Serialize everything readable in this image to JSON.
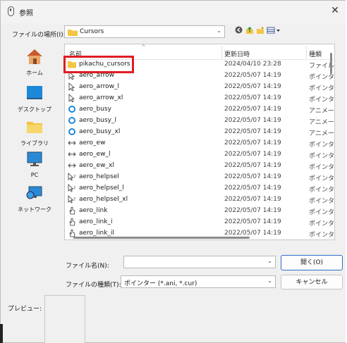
{
  "window": {
    "title": "参照",
    "close_glyph": "✕"
  },
  "location": {
    "label": "ファイルの場所(I):",
    "value": "Cursors"
  },
  "toolbar": {
    "back_glyph": "◀",
    "up_glyph": "↑",
    "newfolder_glyph": "✱",
    "view_glyph": "▤▾"
  },
  "places": [
    {
      "label": "ホーム",
      "icon": "home-icon"
    },
    {
      "label": "デスクトップ",
      "icon": "desktop-icon"
    },
    {
      "label": "ライブラリ",
      "icon": "library-folder-icon"
    },
    {
      "label": "PC",
      "icon": "pc-monitor-icon"
    },
    {
      "label": "ネットワーク",
      "icon": "network-icon"
    }
  ],
  "columns": {
    "name": "名前",
    "date": "更新日時",
    "type": "種類"
  },
  "files": [
    {
      "name": "pikachu_cursors",
      "date": "2024/04/10 23:28",
      "type": "ファイル フ",
      "icon": "folder-icon"
    },
    {
      "name": "aero_arrow",
      "date": "2022/05/07 14:19",
      "type": "ポインター",
      "icon": "arrow-cursor-icon"
    },
    {
      "name": "aero_arrow_l",
      "date": "2022/05/07 14:19",
      "type": "ポインター",
      "icon": "arrow-cursor-icon"
    },
    {
      "name": "aero_arrow_xl",
      "date": "2022/05/07 14:19",
      "type": "ポインター",
      "icon": "arrow-cursor-icon"
    },
    {
      "name": "aero_busy",
      "date": "2022/05/07 14:19",
      "type": "アニメーシ",
      "icon": "busy-ring-icon"
    },
    {
      "name": "aero_busy_l",
      "date": "2022/05/07 14:19",
      "type": "アニメーシ",
      "icon": "busy-ring-icon"
    },
    {
      "name": "aero_busy_xl",
      "date": "2022/05/07 14:19",
      "type": "アニメーシ",
      "icon": "busy-ring-icon"
    },
    {
      "name": "aero_ew",
      "date": "2022/05/07 14:19",
      "type": "ポインター",
      "icon": "resize-ew-icon"
    },
    {
      "name": "aero_ew_l",
      "date": "2022/05/07 14:19",
      "type": "ポインター",
      "icon": "resize-ew-icon"
    },
    {
      "name": "aero_ew_xl",
      "date": "2022/05/07 14:19",
      "type": "ポインター",
      "icon": "resize-ew-icon"
    },
    {
      "name": "aero_helpsel",
      "date": "2022/05/07 14:19",
      "type": "ポインター",
      "icon": "help-cursor-icon"
    },
    {
      "name": "aero_helpsel_l",
      "date": "2022/05/07 14:19",
      "type": "ポインター",
      "icon": "help-cursor-icon"
    },
    {
      "name": "aero_helpsel_xl",
      "date": "2022/05/07 14:19",
      "type": "ポインター",
      "icon": "help-cursor-icon"
    },
    {
      "name": "aero_link",
      "date": "2022/05/07 14:19",
      "type": "ポインター",
      "icon": "hand-cursor-icon"
    },
    {
      "name": "aero_link_i",
      "date": "2022/05/07 14:19",
      "type": "ポインター",
      "icon": "hand-cursor-icon"
    },
    {
      "name": "aero_link_il",
      "date": "2022/05/07 14:19",
      "type": "ポインター",
      "icon": "hand-cursor-icon"
    }
  ],
  "filename": {
    "label": "ファイル名(N):",
    "value": ""
  },
  "filetype": {
    "label": "ファイルの種類(T):",
    "value": "ポインター (*.ani, *.cur)"
  },
  "buttons": {
    "open": "開く(O)",
    "cancel": "キャンセル"
  },
  "preview": {
    "label": "プレビュー:"
  },
  "colors": {
    "highlight": "#e01c24",
    "folder": "#f4c542",
    "accent": "#2d6ec8"
  }
}
